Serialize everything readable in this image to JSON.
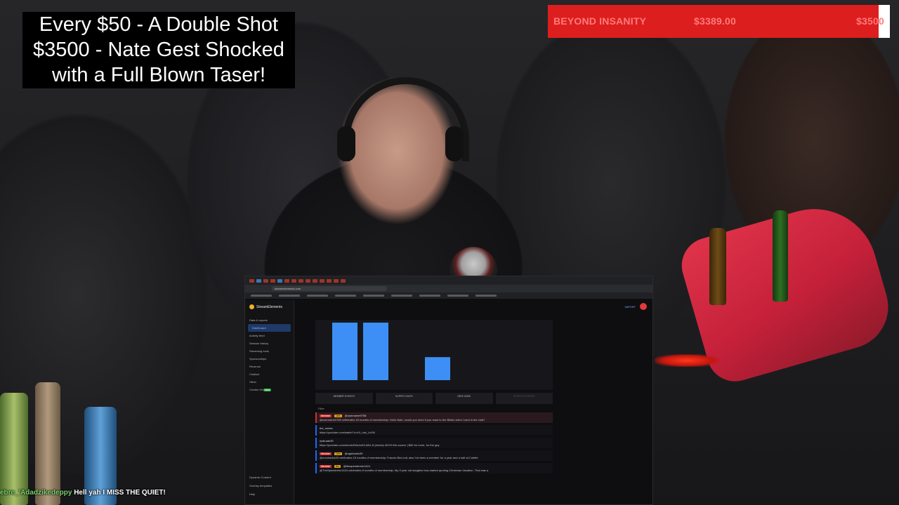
{
  "overlay": {
    "goal_lines": [
      "Every $50 - A Double Shot",
      "$3500 - Nate Gest Shocked",
      "with a Full Blown Taser!"
    ],
    "goal_bar": {
      "name": "BEYOND INSANITY",
      "current": "$3389.00",
      "target": "$3500",
      "progress": 0.968,
      "fill_color": "#dd1e1e",
      "track_color": "#ffffff"
    },
    "chat_ticker": {
      "user": "ebre_'Adadzikedeppy",
      "message": "Hell yah I MISS THE QUIET!"
    }
  },
  "browser": {
    "url": "streamelements.com",
    "app": {
      "brand": "StreamElements",
      "import_label": "IMPORT",
      "sidebar": {
        "items": [
          {
            "label": "Data & reports",
            "active": false
          },
          {
            "label": "Dashboard",
            "active": true
          },
          {
            "label": "Activity feed",
            "active": false
          },
          {
            "label": "Session history",
            "active": false
          },
          {
            "label": "Streaming tools",
            "active": false
          },
          {
            "label": "Sponsorships",
            "active": false
          },
          {
            "label": "Revenue",
            "active": false
          },
          {
            "label": "Chatbot",
            "active": false
          },
          {
            "label": "Other",
            "active": false
          },
          {
            "label": "Creator Kit",
            "active": false
          }
        ],
        "bottom": [
          "Dynamic Content",
          "Overlay templates",
          "Help"
        ],
        "new_badge": "NEW"
      },
      "chart_data": {
        "type": "bar",
        "values": [
          10,
          10,
          0,
          4,
          0,
          0,
          0
        ],
        "ylim": [
          0,
          10
        ],
        "color": "#3d8ff5"
      },
      "stats": [
        "MEMBER EVENTS",
        "SUPER CHATS",
        "NEW SUBS",
        "SUPER STICKERS"
      ],
      "filter_label": "Filter",
      "feed": [
        {
          "badge": "Member",
          "months": "18m",
          "user": "@username9758",
          "text": "@username9758 celebrates 18 months of membership: Hello Nate, would you mind if you react to the Blinks video I sent in the chat?",
          "selected": true
        },
        {
          "badge": "",
          "months": "",
          "user": "the_mutes",
          "text": "https://youtube.com/watch?v=h1l_vtw_Ln2M",
          "selected": false
        },
        {
          "badge": "",
          "months": "",
          "user": "epiknate35",
          "text": "https://youtube.com/shorts/IWa1w93-AN1-8 (shorts) 4DX9 this source | $50 for more, for the guy",
          "selected": false
        },
        {
          "badge": "Member",
          "months": "15m",
          "user": "@ogshanks39",
          "text": "@ourshanks39 celebrates 15 months of membership: Francis Bird cult, also I've been a member for a year and a half at Colette",
          "selected": false
        },
        {
          "badge": "Member",
          "months": "8m",
          "user": "@thespendernic1424",
          "text": "@TheSpendernic1424 celebrates 8 months of membership: My 9 year old daughter has started quoting Christmas Vacation. That was a",
          "selected": false
        }
      ]
    }
  }
}
